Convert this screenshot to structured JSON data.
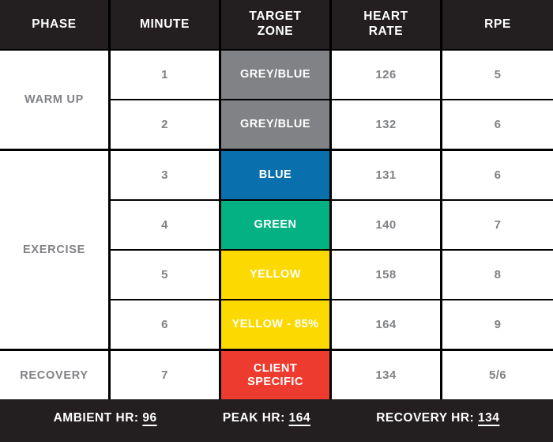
{
  "table": {
    "columns": [
      {
        "id": "phase",
        "label": "PHASE",
        "lines": [
          "PHASE"
        ]
      },
      {
        "id": "minute",
        "label": "MINUTE",
        "lines": [
          "MINUTE"
        ]
      },
      {
        "id": "target_zone",
        "label": "TARGET ZONE",
        "lines": [
          "TARGET",
          "ZONE"
        ]
      },
      {
        "id": "heart_rate",
        "label": "HEART RATE",
        "lines": [
          "HEART",
          "RATE"
        ]
      },
      {
        "id": "rpe",
        "label": "RPE",
        "lines": [
          "RPE"
        ]
      }
    ],
    "blocks": [
      {
        "phase": "WARM UP",
        "rows": [
          {
            "minute": "1",
            "zone": "GREY/BLUE",
            "zone_lines": [
              "GREY/BLUE"
            ],
            "zone_color": "#808285",
            "heart_rate": "126",
            "rpe": "5"
          },
          {
            "minute": "2",
            "zone": "GREY/BLUE",
            "zone_lines": [
              "GREY/BLUE"
            ],
            "zone_color": "#808285",
            "heart_rate": "132",
            "rpe": "6"
          }
        ]
      },
      {
        "phase": "EXERCISE",
        "rows": [
          {
            "minute": "3",
            "zone": "BLUE",
            "zone_lines": [
              "BLUE"
            ],
            "zone_color": "#0a6fad",
            "heart_rate": "131",
            "rpe": "6"
          },
          {
            "minute": "4",
            "zone": "GREEN",
            "zone_lines": [
              "GREEN"
            ],
            "zone_color": "#03b183",
            "heart_rate": "140",
            "rpe": "7"
          },
          {
            "minute": "5",
            "zone": "YELLOW",
            "zone_lines": [
              "YELLOW"
            ],
            "zone_color": "#fcd900",
            "heart_rate": "158",
            "rpe": "8"
          },
          {
            "minute": "6",
            "zone": "YELLOW - 85%",
            "zone_lines": [
              "YELLOW - 85%"
            ],
            "zone_color": "#fcd900",
            "heart_rate": "164",
            "rpe": "9"
          }
        ]
      },
      {
        "phase": "RECOVERY",
        "rows": [
          {
            "minute": "7",
            "zone": "CLIENT SPECIFIC",
            "zone_lines": [
              "CLIENT",
              "SPECIFIC"
            ],
            "zone_color": "#ee3b2f",
            "heart_rate": "134",
            "rpe": "5/6"
          }
        ]
      }
    ]
  },
  "footer": {
    "stats": [
      {
        "id": "ambient-hr",
        "label": "AMBIENT HR:",
        "value": "96"
      },
      {
        "id": "peak-hr",
        "label": "PEAK HR:",
        "value": "164"
      },
      {
        "id": "recovery-hr",
        "label": "RECOVERY HR:",
        "value": "134"
      }
    ]
  },
  "colors": {
    "header_bg": "#231f20",
    "grid_line": "#000000",
    "cell_bg": "#ffffff",
    "cell_text": "#808285",
    "zone_text": "#ffffff",
    "grey": "#808285",
    "blue": "#0a6fad",
    "green": "#03b183",
    "yellow": "#fcd900",
    "red": "#ee3b2f"
  }
}
